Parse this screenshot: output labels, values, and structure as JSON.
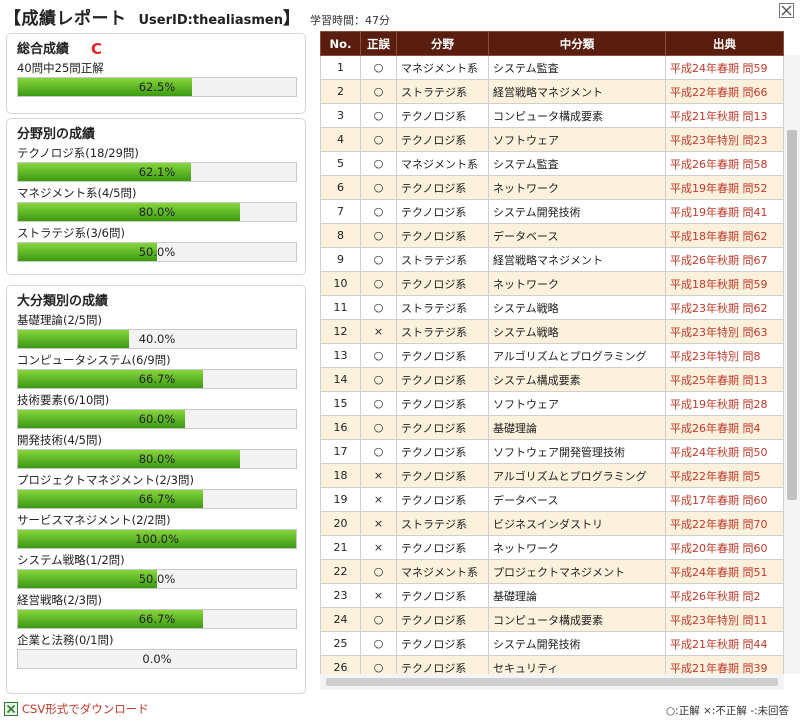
{
  "header": {
    "title": "【成績レポート",
    "user_id": "UserID:thealiasmen",
    "title_tail": "】",
    "study_time": "学習時間：47分"
  },
  "overall": {
    "title": "総合成績",
    "grade": "C",
    "summary": "40問中25問正解",
    "pct_text": "62.5%",
    "pct": 62.5
  },
  "field": {
    "title": "分野別の成績",
    "items": [
      {
        "label": "テクノロジ系(18/29問)",
        "pct_text": "62.1%",
        "pct": 62.1
      },
      {
        "label": "マネジメント系(4/5問)",
        "pct_text": "80.0%",
        "pct": 80.0
      },
      {
        "label": "ストラテジ系(3/6問)",
        "pct_text": "50.0%",
        "pct": 50.0
      }
    ]
  },
  "category": {
    "title": "大分類別の成績",
    "items": [
      {
        "label": "基礎理論(2/5問)",
        "pct_text": "40.0%",
        "pct": 40.0
      },
      {
        "label": "コンピュータシステム(6/9問)",
        "pct_text": "66.7%",
        "pct": 66.7
      },
      {
        "label": "技術要素(6/10問)",
        "pct_text": "60.0%",
        "pct": 60.0
      },
      {
        "label": "開発技術(4/5問)",
        "pct_text": "80.0%",
        "pct": 80.0
      },
      {
        "label": "プロジェクトマネジメント(2/3問)",
        "pct_text": "66.7%",
        "pct": 66.7
      },
      {
        "label": "サービスマネジメント(2/2問)",
        "pct_text": "100.0%",
        "pct": 100.0
      },
      {
        "label": "システム戦略(1/2問)",
        "pct_text": "50.0%",
        "pct": 50.0
      },
      {
        "label": "経営戦略(2/3問)",
        "pct_text": "66.7%",
        "pct": 66.7
      },
      {
        "label": "企業と法務(0/1問)",
        "pct_text": "0.0%",
        "pct": 0.0
      }
    ]
  },
  "table": {
    "headers": [
      "No.",
      "正誤",
      "分野",
      "中分類",
      "出典"
    ],
    "rows": [
      [
        "1",
        "○",
        "マネジメント系",
        "システム監査",
        "平成24年春期 問59"
      ],
      [
        "2",
        "○",
        "ストラテジ系",
        "経営戦略マネジメント",
        "平成22年春期 問66"
      ],
      [
        "3",
        "○",
        "テクノロジ系",
        "コンピュータ構成要素",
        "平成21年秋期 問13"
      ],
      [
        "4",
        "○",
        "テクノロジ系",
        "ソフトウェア",
        "平成23年特別 問23"
      ],
      [
        "5",
        "○",
        "マネジメント系",
        "システム監査",
        "平成26年春期 問58"
      ],
      [
        "6",
        "○",
        "テクノロジ系",
        "ネットワーク",
        "平成19年春期 問52"
      ],
      [
        "7",
        "○",
        "テクノロジ系",
        "システム開発技術",
        "平成19年春期 問41"
      ],
      [
        "8",
        "○",
        "テクノロジ系",
        "データベース",
        "平成18年春期 問62"
      ],
      [
        "9",
        "○",
        "ストラテジ系",
        "経営戦略マネジメント",
        "平成26年秋期 問67"
      ],
      [
        "10",
        "○",
        "テクノロジ系",
        "ネットワーク",
        "平成18年秋期 問59"
      ],
      [
        "11",
        "○",
        "ストラテジ系",
        "システム戦略",
        "平成23年秋期 問62"
      ],
      [
        "12",
        "×",
        "ストラテジ系",
        "システム戦略",
        "平成23年特別 問63"
      ],
      [
        "13",
        "○",
        "テクノロジ系",
        "アルゴリズムとプログラミング",
        "平成23年特別 問8"
      ],
      [
        "14",
        "○",
        "テクノロジ系",
        "システム構成要素",
        "平成25年春期 問13"
      ],
      [
        "15",
        "○",
        "テクノロジ系",
        "ソフトウェア",
        "平成19年秋期 問28"
      ],
      [
        "16",
        "○",
        "テクノロジ系",
        "基礎理論",
        "平成26年春期 問4"
      ],
      [
        "17",
        "○",
        "テクノロジ系",
        "ソフトウェア開発管理技術",
        "平成24年秋期 問50"
      ],
      [
        "18",
        "×",
        "テクノロジ系",
        "アルゴリズムとプログラミング",
        "平成22年春期 問5"
      ],
      [
        "19",
        "×",
        "テクノロジ系",
        "データベース",
        "平成17年春期 問60"
      ],
      [
        "20",
        "×",
        "ストラテジ系",
        "ビジネスインダストリ",
        "平成22年春期 問70"
      ],
      [
        "21",
        "×",
        "テクノロジ系",
        "ネットワーク",
        "平成20年春期 問60"
      ],
      [
        "22",
        "○",
        "マネジメント系",
        "プロジェクトマネジメント",
        "平成24年春期 問51"
      ],
      [
        "23",
        "×",
        "テクノロジ系",
        "基礎理論",
        "平成26年秋期 問2"
      ],
      [
        "24",
        "○",
        "テクノロジ系",
        "コンピュータ構成要素",
        "平成23年特別 問11"
      ],
      [
        "25",
        "○",
        "テクノロジ系",
        "システム開発技術",
        "平成21年秋期 問44"
      ],
      [
        "26",
        "○",
        "テクノロジ系",
        "セキュリティ",
        "平成21年春期 問39"
      ]
    ]
  },
  "footer": {
    "csv_label": "CSV形式でダウンロード",
    "legend": "○:正解 ×:不正解 -:未回答"
  },
  "colors": {
    "header_bg": "#5a1e10",
    "row_alt_bg": "#fbf1dd",
    "bar_fill": "#3c9a13",
    "grade": "#e02020",
    "source_link": "#c0392b"
  }
}
